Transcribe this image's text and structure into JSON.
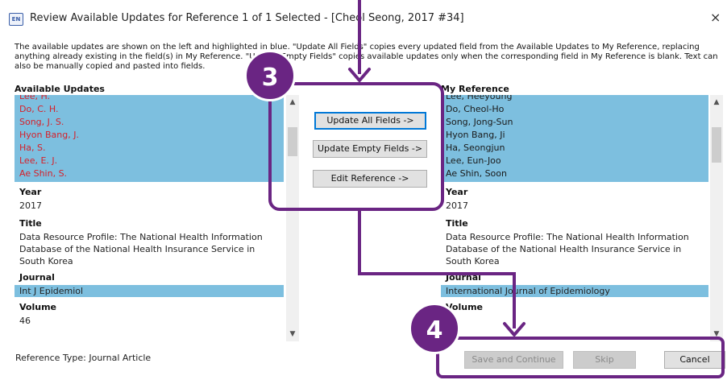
{
  "window": {
    "icon_label": "EN",
    "title": "Review Available Updates for Reference 1 of 1 Selected - [Cheol Seong, 2017 #34]",
    "close_glyph": "×"
  },
  "description": "The available updates are shown on the left and highlighted in blue. \"Update All Fields\" copies every updated field from the Available Updates to My Reference, replacing anything already existing in the field(s) in My Reference. \"Update Empty Fields\" copies available updates only when the corresponding field in My Reference is blank. Text can also be manually copied and pasted into fields.",
  "left": {
    "header": "Available Updates",
    "authors": [
      "Lee, H.",
      "Do, C. H.",
      "Song, J. S.",
      "Hyon Bang, J.",
      "Ha, S.",
      "Lee, E. J.",
      "Ae Shin, S."
    ],
    "year_label": "Year",
    "year": "2017",
    "title_label": "Title",
    "title": "Data Resource Profile: The National Health Information Database of the National Health Insurance Service in South Korea",
    "journal_label": "Journal",
    "journal": "Int J Epidemiol",
    "volume_label": "Volume",
    "volume": "46"
  },
  "right": {
    "header": "My Reference",
    "authors": [
      "Lee, Heeyoung",
      "Do, Cheol-Ho",
      "Song, Jong-Sun",
      "Hyon Bang, Ji",
      "Ha, Seongjun",
      "Lee, Eun-Joo",
      "Ae Shin, Soon"
    ],
    "year_label": "Year",
    "year": "2017",
    "title_label": "Title",
    "title": "Data Resource Profile: The National Health Information Database of the National Health Insurance Service in South Korea",
    "journal_label": "Journal",
    "journal": "International Journal of Epidemiology",
    "volume_label": "Volume"
  },
  "buttons": {
    "update_all": "Update All Fields ->",
    "update_empty": "Update Empty Fields ->",
    "edit_reference": "Edit Reference ->",
    "save_continue": "Save and Continue",
    "skip": "Skip",
    "cancel": "Cancel"
  },
  "footer": {
    "reference_type": "Reference Type: Journal Article"
  },
  "annotations": {
    "step3": "3",
    "step4": "4",
    "color": "#6a2583"
  },
  "colors": {
    "selection": "#7dbfdf",
    "changed_text": "#d6202a"
  }
}
